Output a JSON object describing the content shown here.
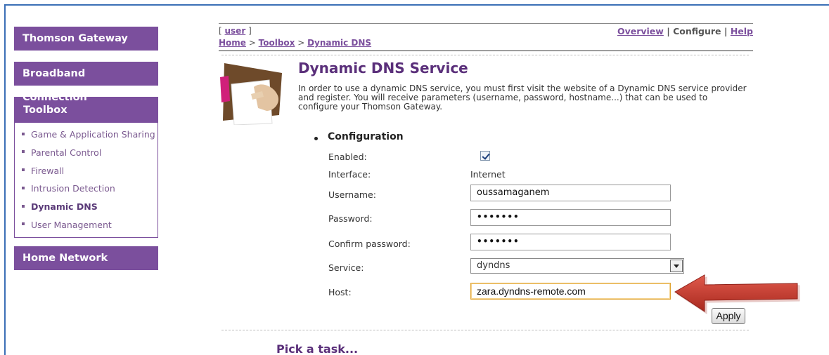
{
  "sidebar": {
    "sections": {
      "gateway": "Thomson Gateway",
      "broadband": "Broadband Connection",
      "toolbox": "Toolbox",
      "home_network": "Home Network"
    },
    "toolbox_items": [
      {
        "label": "Game & Application Sharing"
      },
      {
        "label": "Parental Control"
      },
      {
        "label": "Firewall"
      },
      {
        "label": "Intrusion Detection"
      },
      {
        "label": "Dynamic DNS",
        "active": true
      },
      {
        "label": "User Management"
      }
    ]
  },
  "header": {
    "user_open": "[ ",
    "user": "user",
    "user_close": " ]",
    "breadcrumb": {
      "home": "Home",
      "sep": " > ",
      "toolbox": "Toolbox",
      "current": "Dynamic DNS"
    },
    "nav": {
      "overview": "Overview",
      "sep": " | ",
      "configure": "Configure",
      "help": "Help"
    }
  },
  "main": {
    "title": "Dynamic DNS Service",
    "description": "In order to use a dynamic DNS service, you must first visit the website of a Dynamic DNS service provider and register. You will receive parameters (username, password, hostname...) that can be used to configure your Thomson Gateway.",
    "section_title": "Configuration",
    "form": {
      "enabled_label": "Enabled:",
      "enabled": true,
      "interface_label": "Interface:",
      "interface_value": "Internet",
      "username_label": "Username:",
      "username_value": "oussamaganem",
      "password_label": "Password:",
      "password_value": "•••••••",
      "confirm_label": "Confirm password:",
      "confirm_value": "•••••••",
      "service_label": "Service:",
      "service_value": "dyndns",
      "host_label": "Host:",
      "host_value": "zara.dyndns-remote.com"
    },
    "apply_label": "Apply",
    "pick_task": "Pick a task..."
  },
  "colors": {
    "brand_purple": "#7b4f9d",
    "title_purple": "#5a2f7a",
    "annotation_arrow": "#c0392b"
  }
}
